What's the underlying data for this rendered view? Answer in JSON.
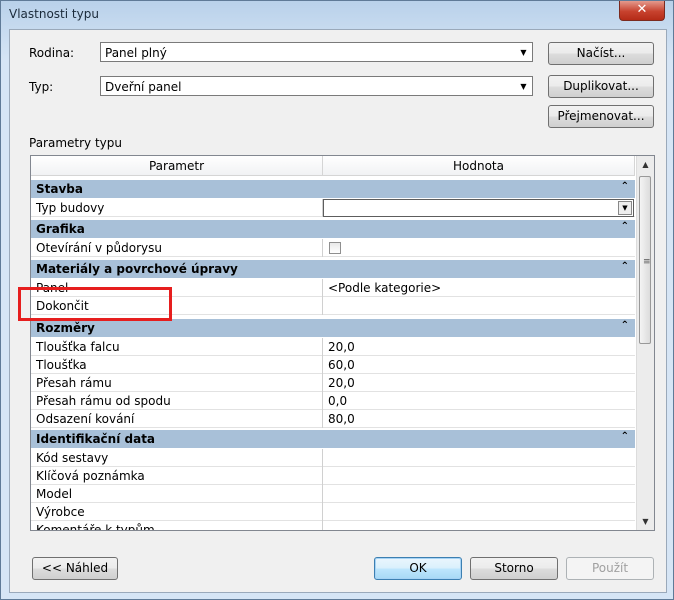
{
  "window": {
    "title": "Vlastnosti typu",
    "close_glyph": "✕"
  },
  "family": {
    "label": "Rodina:",
    "value": "Panel plný"
  },
  "type": {
    "label": "Typ:",
    "value": "Dveřní panel"
  },
  "buttons": {
    "load": "Načíst...",
    "duplicate": "Duplikovat...",
    "rename": "Přejmenovat...",
    "preview": "<< Náhled",
    "ok": "OK",
    "cancel": "Storno",
    "apply": "Použít"
  },
  "type_params_label": "Parametry typu",
  "grid": {
    "headers": {
      "param": "Parametr",
      "value": "Hodnota"
    },
    "groups": {
      "stavba": "Stavba",
      "grafika": "Grafika",
      "materialy": "Materiály a povrchové úpravy",
      "rozmery": "Rozměry",
      "identifikace": "Identifikační data"
    },
    "rows": {
      "typ_budovy": "Typ budovy",
      "otevirani": "Otevírání v půdorysu",
      "panel": "Panel",
      "panel_value": "<Podle kategorie>",
      "dokoncit": "Dokončit",
      "tloustka_falcu": "Tloušťka falcu",
      "tloustka_falcu_value": "20,0",
      "tloustka": "Tloušťka",
      "tloustka_value": "60,0",
      "presah_ramu": "Přesah rámu",
      "presah_ramu_value": "20,0",
      "presah_ramu_od_spodu": "Přesah rámu od spodu",
      "presah_ramu_od_spodu_value": "0,0",
      "odsazeni_kovani": "Odsazení kování",
      "odsazeni_kovani_value": "80,0",
      "kod_sestavy": "Kód sestavy",
      "klicova_poznamka": "Klíčová poznámka",
      "model": "Model",
      "vyrobce": "Výrobce",
      "komentare": "Komentáře k typům"
    },
    "collapse_glyph": "⌃"
  },
  "colors": {
    "group_bg": "#a8c0d8",
    "highlight": "#e61e1e"
  }
}
